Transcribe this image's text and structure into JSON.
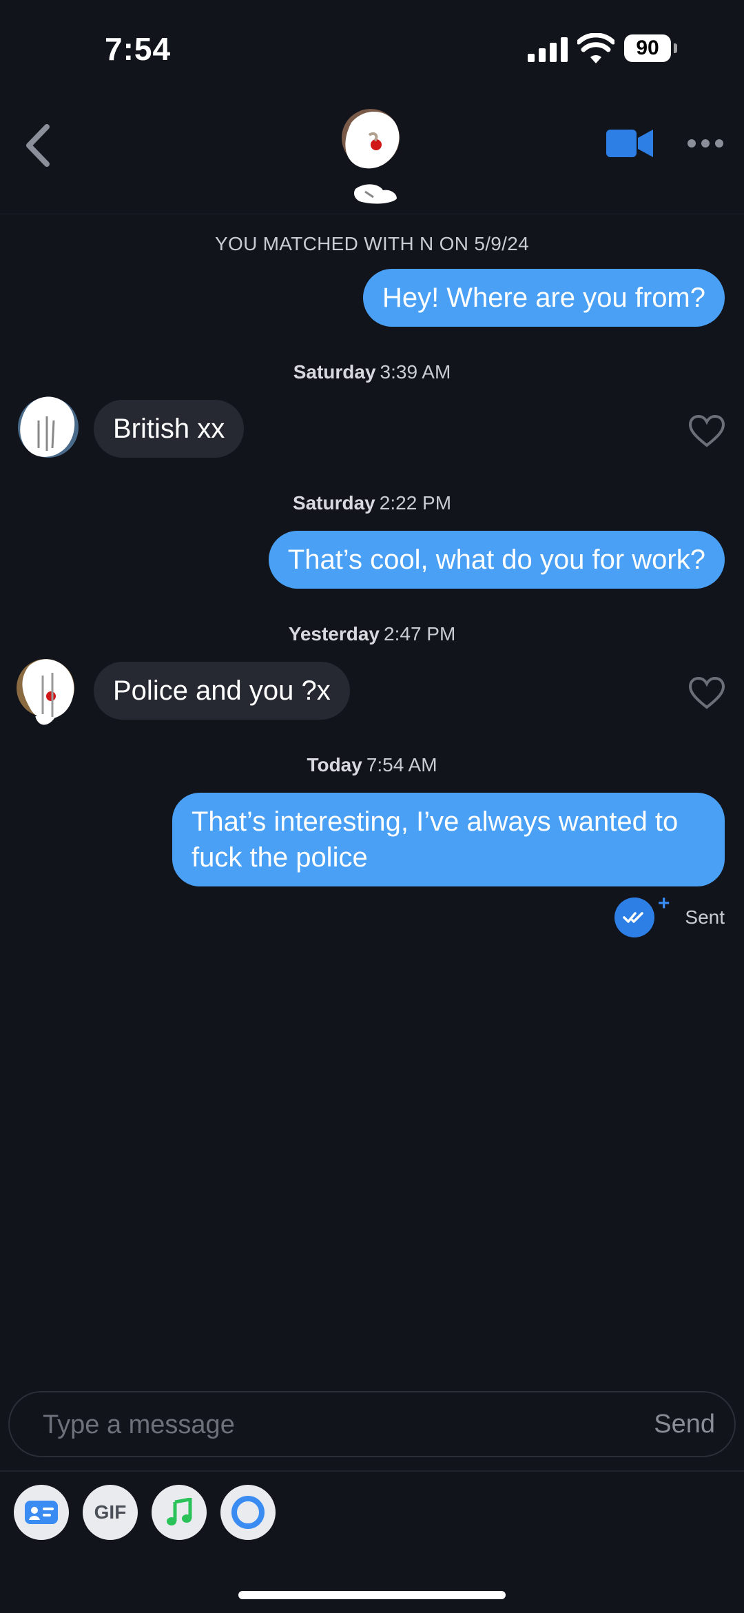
{
  "status_bar": {
    "time": "7:54",
    "battery": "90"
  },
  "header": {},
  "match_notice": "YOU MATCHED WITH N ON 5/9/24",
  "messages": [
    {
      "type": "out",
      "text": "Hey! Where are you from?"
    },
    {
      "type": "time",
      "day": "Saturday",
      "time": "3:39 AM"
    },
    {
      "type": "in",
      "text": "British xx"
    },
    {
      "type": "time",
      "day": "Saturday",
      "time": "2:22 PM"
    },
    {
      "type": "out",
      "text": "That’s cool, what do you for work?"
    },
    {
      "type": "time",
      "day": "Yesterday",
      "time": "2:47 PM"
    },
    {
      "type": "in",
      "text": "Police and you ?x"
    },
    {
      "type": "time",
      "day": "Today",
      "time": "7:54 AM"
    },
    {
      "type": "out",
      "text": "That’s interesting, I’ve always wanted to fuck the police"
    }
  ],
  "sent_status": {
    "plus": "+",
    "label": "Sent"
  },
  "composer": {
    "placeholder": "Type a message",
    "send_label": "Send"
  },
  "toolbar": {
    "gif_label": "GIF"
  },
  "colors": {
    "accent": "#4aa0f5",
    "background": "#11141b",
    "incoming_bubble": "#262931",
    "music": "#2bc25a"
  },
  "icons": [
    "back-chevron-icon",
    "video-call-icon",
    "more-options-icon",
    "heart-icon",
    "double-check-icon",
    "id-card-icon",
    "music-note-icon",
    "circle-ring-icon"
  ]
}
